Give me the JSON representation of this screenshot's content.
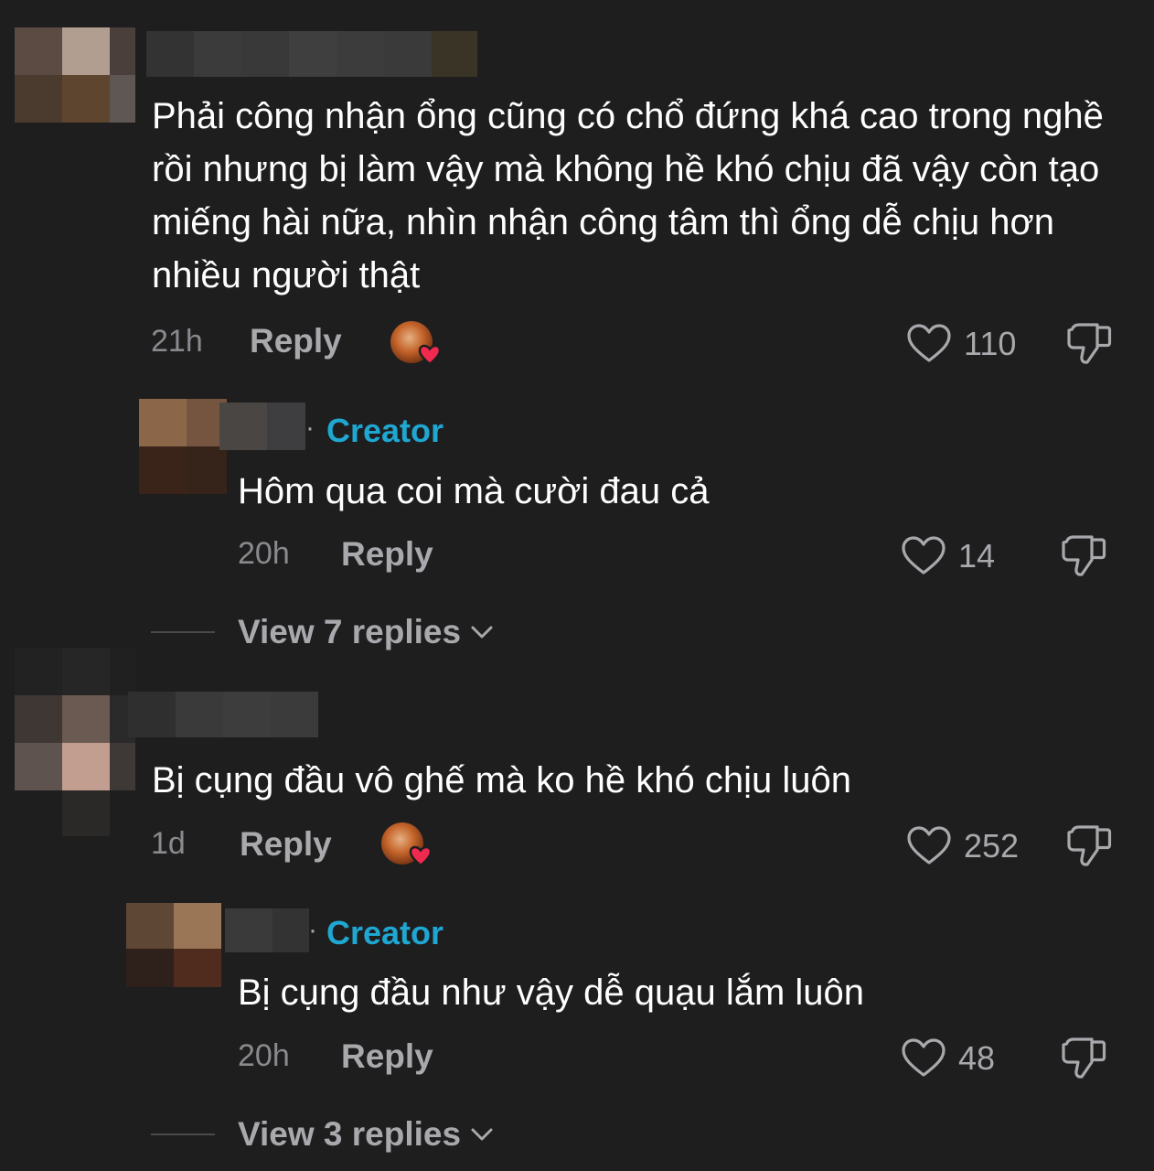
{
  "comments": [
    {
      "text": "Phải công nhận ổng cũng có chổ đứng khá cao trong nghề rồi nhưng bị làm vậy mà không hề khó chịu đã vậy còn tạo miếng hài nữa, nhìn nhận công tâm thì ổng dễ chịu hơn nhiều người thật",
      "time": "21h",
      "reply_label": "Reply",
      "likes": "110",
      "creator_liked": true,
      "reply": {
        "badge": "Creator",
        "text": "Hôm qua coi mà cười đau cả",
        "time": "20h",
        "reply_label": "Reply",
        "likes": "14"
      },
      "view_replies": "View 7 replies"
    },
    {
      "text": "Bị cụng đầu vô ghế mà ko hề khó chịu luôn",
      "time": "1d",
      "reply_label": "Reply",
      "likes": "252",
      "creator_liked": true,
      "reply": {
        "badge": "Creator",
        "text": "Bị cụng đầu như vậy dễ quạu lắm luôn",
        "time": "20h",
        "reply_label": "Reply",
        "likes": "48"
      },
      "view_replies": "View 3 replies"
    }
  ],
  "colors": {
    "background": "#1e1e1f",
    "creator_badge": "#1fa6d1",
    "heart_badge": "#f0294f"
  },
  "icons": {
    "like": "heart-outline-icon",
    "dislike": "thumbs-down-icon",
    "expand": "chevron-down-icon",
    "creator_like": "creator-heart-avatar-icon"
  }
}
